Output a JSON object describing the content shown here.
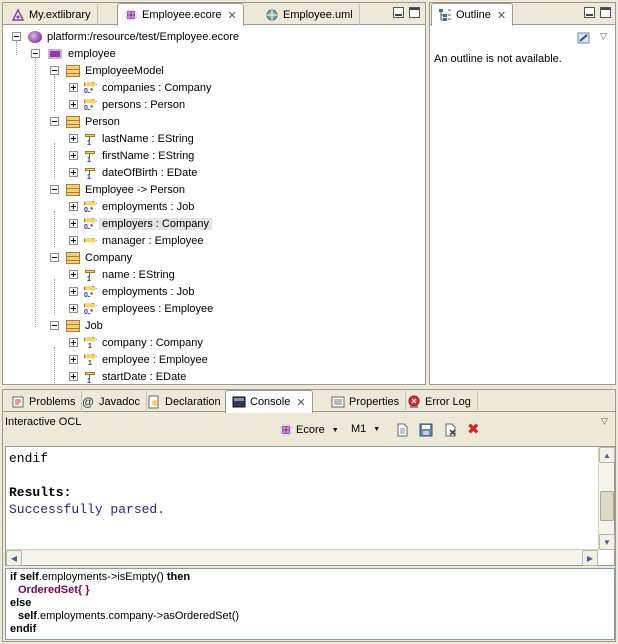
{
  "editor_tabs": [
    {
      "label": "My.extlibrary",
      "icon": "extlibrary-icon"
    },
    {
      "label": "Employee.ecore",
      "icon": "ecore-icon",
      "active": true
    },
    {
      "label": "Employee.uml",
      "icon": "uml-icon"
    }
  ],
  "tree": {
    "resource": "platform:/resource/test/Employee.ecore",
    "package": "employee",
    "classes": [
      {
        "name": "EmployeeModel",
        "features": [
          {
            "label": "companies : Company",
            "kind": "ref-many"
          },
          {
            "label": "persons : Person",
            "kind": "ref-many"
          }
        ]
      },
      {
        "name": "Person",
        "features": [
          {
            "label": "lastName : EString",
            "kind": "attr"
          },
          {
            "label": "firstName : EString",
            "kind": "attr"
          },
          {
            "label": "dateOfBirth : EDate",
            "kind": "attr"
          }
        ]
      },
      {
        "name": "Employee -> Person",
        "features": [
          {
            "label": "employments : Job",
            "kind": "ref-many"
          },
          {
            "label": "employers : Company",
            "kind": "ref-many",
            "selected": true
          },
          {
            "label": "manager : Employee",
            "kind": "ref"
          }
        ]
      },
      {
        "name": "Company",
        "features": [
          {
            "label": "name : EString",
            "kind": "attr"
          },
          {
            "label": "employments : Job",
            "kind": "ref-many"
          },
          {
            "label": "employees : Employee",
            "kind": "ref-many"
          }
        ]
      },
      {
        "name": "Job",
        "features": [
          {
            "label": "company : Company",
            "kind": "ref-one"
          },
          {
            "label": "employee : Employee",
            "kind": "ref-one"
          },
          {
            "label": "startDate : EDate",
            "kind": "attr"
          }
        ]
      }
    ]
  },
  "multiplicity": {
    "one": "1",
    "many": "0..*"
  },
  "outline": {
    "tab": "Outline",
    "message": "An outline is not available."
  },
  "bottom_tabs": [
    {
      "label": "Problems",
      "icon": "problems-icon"
    },
    {
      "label": "Javadoc",
      "icon": "javadoc-icon"
    },
    {
      "label": "Declaration",
      "icon": "declaration-icon"
    },
    {
      "label": "Console",
      "icon": "console-icon",
      "active": true
    },
    {
      "label": "Properties",
      "icon": "properties-icon"
    },
    {
      "label": "Error Log",
      "icon": "error-log-icon"
    }
  ],
  "console": {
    "title": "Interactive OCL",
    "toolbar": {
      "metamodel": "Ecore",
      "level": "M1"
    },
    "output": {
      "line1": "endif",
      "results_label": "Results:",
      "message": "Successfully parsed."
    },
    "input": {
      "l1_kw1": "if",
      "l1_kw2": "self",
      "l1_rest": ".employments->isEmpty() ",
      "l1_kw3": "then",
      "l2": "OrderedSet{ }",
      "l3": "else",
      "l4_kw": "self",
      "l4_rest": ".employments.company->asOrderedSet()",
      "l5": "endif"
    }
  },
  "colors": {
    "selection": "#e4e4e4",
    "results_text": "#2a1aa0",
    "keyword_purple": "#7f0055"
  }
}
